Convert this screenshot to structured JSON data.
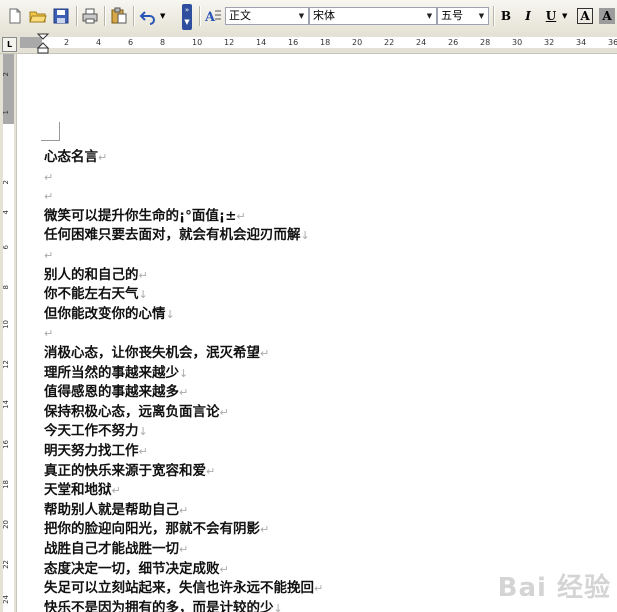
{
  "toolbar": {
    "style": "正文",
    "font": "宋体",
    "size": "五号",
    "bold": "B",
    "italic": "I",
    "underline": "U",
    "char_border": "A",
    "char_shading": "A"
  },
  "ruler": {
    "tab_marker": "L",
    "h_ticks": [
      "2",
      "4",
      "6",
      "8",
      "10",
      "12",
      "14",
      "16",
      "18",
      "20",
      "22",
      "24",
      "26",
      "28",
      "30",
      "32",
      "34",
      "36"
    ],
    "v_ticks": [
      "2",
      "1",
      "2",
      "4",
      "6",
      "8",
      "10",
      "12",
      "14",
      "16",
      "18",
      "20",
      "22",
      "24"
    ]
  },
  "document": {
    "lines": [
      {
        "text": "心态名言",
        "mark": "↵"
      },
      {
        "text": "",
        "mark": "↵"
      },
      {
        "text": "",
        "mark": "↵"
      },
      {
        "text": "微笑可以提升你生命的¡°面值¡±",
        "mark": "↵"
      },
      {
        "text": "任何困难只要去面对，就会有机会迎刃而解",
        "mark": "↓"
      },
      {
        "text": "",
        "mark": "↵"
      },
      {
        "text": "别人的和自己的",
        "mark": "↵"
      },
      {
        "text": "你不能左右天气",
        "mark": "↓"
      },
      {
        "text": "但你能改变你的心情",
        "mark": "↓"
      },
      {
        "text": "",
        "mark": "↵"
      },
      {
        "text": "消极心态，让你丧失机会，泯灭希望",
        "mark": "↵"
      },
      {
        "text": "理所当然的事越来越少",
        "mark": "↓"
      },
      {
        "text": "值得感恩的事越来越多",
        "mark": "↵"
      },
      {
        "text": "保持积极心态，远离负面言论",
        "mark": "↵"
      },
      {
        "text": "今天工作不努力",
        "mark": "↓"
      },
      {
        "text": "明天努力找工作",
        "mark": "↵"
      },
      {
        "text": "真正的快乐来源于宽容和爱",
        "mark": "↵"
      },
      {
        "text": "天堂和地狱",
        "mark": "↵"
      },
      {
        "text": "帮助别人就是帮助自己",
        "mark": "↵"
      },
      {
        "text": "把你的脸迎向阳光，那就不会有阴影",
        "mark": "↵"
      },
      {
        "text": "战胜自己才能战胜一切",
        "mark": "↵"
      },
      {
        "text": "态度决定一切，细节决定成败",
        "mark": "↵"
      },
      {
        "text": "失足可以立刻站起来，失信也许永远不能挽回",
        "mark": "↵"
      },
      {
        "text": "快乐不是因为拥有的多，而是计较的少",
        "mark": "↓"
      }
    ]
  },
  "watermark": "Bai 经验"
}
